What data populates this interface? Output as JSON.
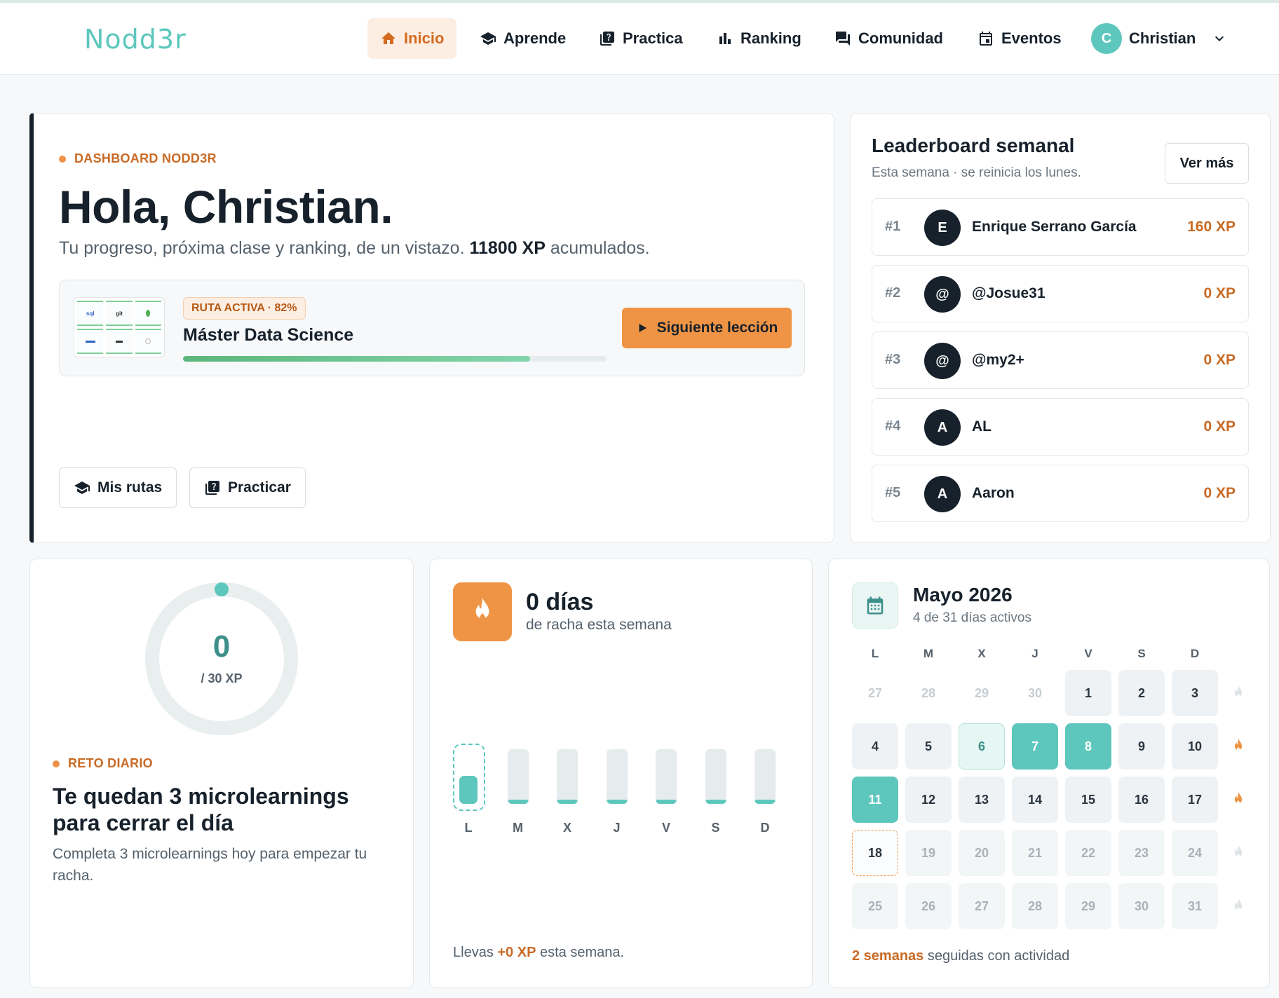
{
  "nav": {
    "logo": "Nodd3r",
    "items": [
      {
        "label": "Inicio",
        "icon": "home-icon",
        "active": true
      },
      {
        "label": "Aprende",
        "icon": "graduation-cap-icon"
      },
      {
        "label": "Practica",
        "icon": "quiz-icon"
      },
      {
        "label": "Ranking",
        "icon": "bar-chart-icon"
      },
      {
        "label": "Comunidad",
        "icon": "forum-icon"
      },
      {
        "label": "Eventos",
        "icon": "calendar-icon"
      }
    ],
    "user": {
      "initial": "C",
      "name": "Christian"
    }
  },
  "hero": {
    "eyebrow": "DASHBOARD NODD3R",
    "title": "Hola, Christian.",
    "subtitle_prefix": "Tu progreso, próxima clase y ranking, de un vistazo.",
    "xp_total": "11800 XP",
    "subtitle_suffix": "acumulados.",
    "route": {
      "badge": "RUTA ACTIVA · 82%",
      "name": "Máster Data Science",
      "progress": 0.82,
      "thumb_tiles": [
        "sql",
        "git",
        "",
        "",
        "",
        ""
      ],
      "cta": "Siguiente lección"
    },
    "btn_routes": "Mis rutas",
    "btn_practice": "Practicar"
  },
  "leaderboard": {
    "title": "Leaderboard semanal",
    "subtitle": "Esta semana · se reinicia los lunes.",
    "more": "Ver más",
    "rows": [
      {
        "rank": "#1",
        "initial": "E",
        "name": "Enrique Serrano García",
        "xp": "160 XP"
      },
      {
        "rank": "#2",
        "initial": "@",
        "name": "@Josue31",
        "xp": "0 XP"
      },
      {
        "rank": "#3",
        "initial": "@",
        "name": "@my2+",
        "xp": "0 XP"
      },
      {
        "rank": "#4",
        "initial": "A",
        "name": "AL",
        "xp": "0 XP"
      },
      {
        "rank": "#5",
        "initial": "A",
        "name": "Aaron",
        "xp": "0 XP"
      }
    ]
  },
  "daily": {
    "value": "0",
    "goal": "/ 30 XP",
    "progress": 0,
    "eyebrow": "RETO DIARIO",
    "title": "Te quedan 3 microlearnings para cerrar el día",
    "desc": "Completa 3 microlearnings hoy para empezar tu racha."
  },
  "streak": {
    "days": "0 días",
    "subtitle": "de racha esta semana",
    "weekdays": [
      "L",
      "M",
      "X",
      "J",
      "V",
      "S",
      "D"
    ],
    "today_index": 0,
    "foot_prefix": "Llevas",
    "foot_xp": "+0 XP",
    "foot_suffix": "esta semana."
  },
  "calendar": {
    "title": "Mayo 2026",
    "subtitle": "4 de 31 días activos",
    "headers": [
      "L",
      "M",
      "X",
      "J",
      "V",
      "S",
      "D"
    ],
    "weeks": [
      [
        {
          "d": "27",
          "s": "out"
        },
        {
          "d": "28",
          "s": "out"
        },
        {
          "d": "29",
          "s": "out"
        },
        {
          "d": "30",
          "s": "out"
        },
        {
          "d": "1",
          "s": "norm"
        },
        {
          "d": "2",
          "s": "norm"
        },
        {
          "d": "3",
          "s": "norm"
        }
      ],
      [
        {
          "d": "4",
          "s": "norm"
        },
        {
          "d": "5",
          "s": "norm"
        },
        {
          "d": "6",
          "s": "light"
        },
        {
          "d": "7",
          "s": "active"
        },
        {
          "d": "8",
          "s": "active"
        },
        {
          "d": "9",
          "s": "norm"
        },
        {
          "d": "10",
          "s": "norm"
        }
      ],
      [
        {
          "d": "11",
          "s": "active"
        },
        {
          "d": "12",
          "s": "norm"
        },
        {
          "d": "13",
          "s": "norm"
        },
        {
          "d": "14",
          "s": "norm"
        },
        {
          "d": "15",
          "s": "norm"
        },
        {
          "d": "16",
          "s": "norm"
        },
        {
          "d": "17",
          "s": "norm"
        }
      ],
      [
        {
          "d": "18",
          "s": "today"
        },
        {
          "d": "19",
          "s": "future"
        },
        {
          "d": "20",
          "s": "future"
        },
        {
          "d": "21",
          "s": "future"
        },
        {
          "d": "22",
          "s": "future"
        },
        {
          "d": "23",
          "s": "future"
        },
        {
          "d": "24",
          "s": "future"
        }
      ],
      [
        {
          "d": "25",
          "s": "future"
        },
        {
          "d": "26",
          "s": "future"
        },
        {
          "d": "27",
          "s": "future"
        },
        {
          "d": "28",
          "s": "future"
        },
        {
          "d": "29",
          "s": "future"
        },
        {
          "d": "30",
          "s": "future"
        },
        {
          "d": "31",
          "s": "future"
        }
      ]
    ],
    "week_flames": [
      false,
      true,
      true,
      false,
      false
    ],
    "foot_bold": "2 semanas",
    "foot_rest": "seguidas con actividad"
  },
  "colors": {
    "accent_teal": "#5ec7bd",
    "accent_orange": "#ef9445",
    "text_orange": "#c96a24",
    "ink": "#17212b"
  }
}
